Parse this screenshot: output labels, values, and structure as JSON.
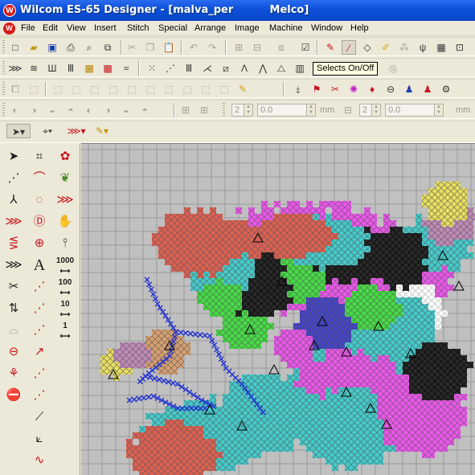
{
  "window": {
    "title": "Wilcom ES-65 Designer - [malva_per          Melco]"
  },
  "menubar": {
    "items": [
      "File",
      "Edit",
      "View",
      "Insert",
      "Stitch",
      "Special",
      "Arrange",
      "Image",
      "Machine",
      "Window",
      "Help"
    ]
  },
  "tooltip": {
    "text": "Selects On/Off"
  },
  "offset_toolbar": {
    "x_value": "2",
    "x_offset": "0.0",
    "x_unit": "mm",
    "y_value": "2",
    "y_offset": "0.0",
    "y_unit": "mm"
  },
  "left_toolbox": {
    "labels": [
      "A",
      "1000",
      "100",
      "10",
      "1"
    ]
  },
  "icons": {
    "standard": [
      "new-icon",
      "open-icon",
      "save-icon",
      "print-icon",
      "print-preview-icon",
      "export-icon",
      "cut-icon",
      "copy-icon",
      "paste-icon",
      "undo-icon",
      "redo-icon",
      "group-icon",
      "ungroup-icon",
      "sequence-icon",
      "checkbox-icon",
      "stitch-red-icon",
      "stitch-pink-icon",
      "outline-icon",
      "hoop-icon",
      "needle-icon",
      "grid-icon",
      "zoom-icon"
    ],
    "colors": {
      "accent_red": "#c8141e",
      "accent_blue": "#1c3fa8",
      "xp_blue": "#0b4fd9"
    }
  }
}
